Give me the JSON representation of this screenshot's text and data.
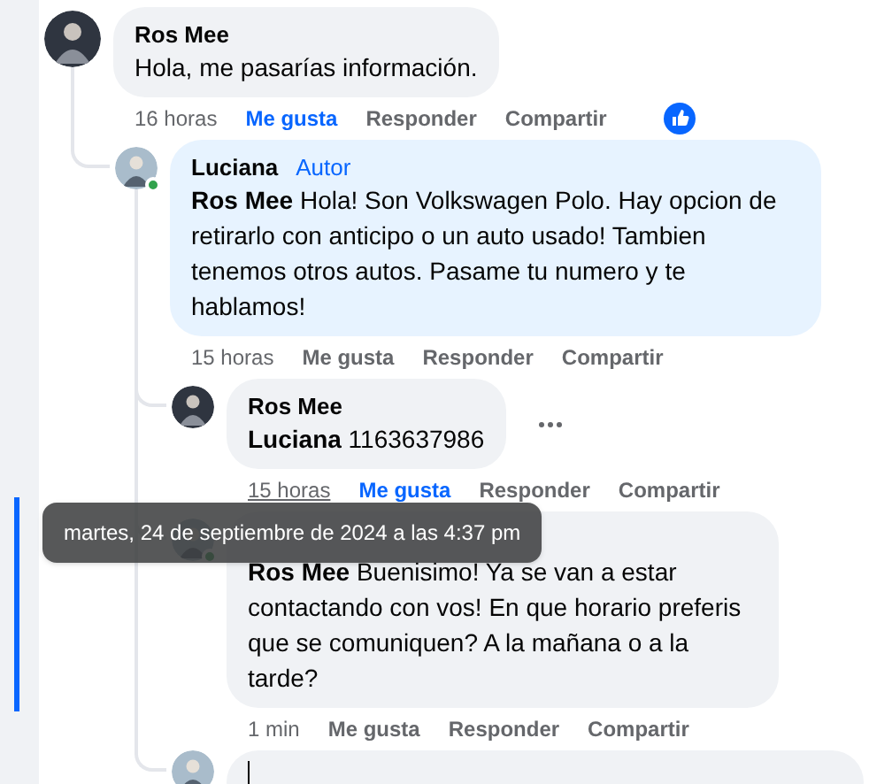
{
  "comments": [
    {
      "author": "Ros Mee",
      "text": "Hola, me pasarías información.",
      "time": "16 horas",
      "time_hovered": false,
      "liked": true,
      "reacted": true,
      "online": false,
      "highlighted": false,
      "actions": [
        "Me gusta",
        "Responder",
        "Compartir"
      ],
      "replies": [
        {
          "author": "Luciana",
          "badge": "Autor",
          "text": "**Ros Mee** Hola! Son Volkswagen Polo. Hay opcion de retirarlo con anticipo o un auto usado! Tambien tenemos otros autos. Pasame tu numero y te hablamos!",
          "time": "15 horas",
          "time_hovered": false,
          "liked": false,
          "reacted": false,
          "online": true,
          "highlighted": false,
          "actions": [
            "Me gusta",
            "Responder",
            "Compartir"
          ],
          "replies": [
            {
              "author": "Ros Mee",
              "text": "**Luciana** 1163637986",
              "time": "15 horas",
              "time_hovered": true,
              "liked": true,
              "reacted": false,
              "online": false,
              "highlighted": false,
              "menu_visible": true,
              "actions": [
                "Me gusta",
                "Responder",
                "Compartir"
              ]
            },
            {
              "text": "**Ros Mee** Buenisimo! Ya se van a estar contactando con vos! En que horario preferis que se comuniquen? A la mañana o a la tarde?",
              "time": "1 min",
              "time_hovered": false,
              "liked": false,
              "reacted": false,
              "online": true,
              "highlighted": true,
              "actions": [
                "Me gusta",
                "Responder",
                "Compartir"
              ]
            }
          ],
          "composer": {
            "focused": true
          }
        }
      ]
    }
  ],
  "tooltip": {
    "text": "martes, 24 de septiembre de 2024 a las 4:37 pm"
  }
}
